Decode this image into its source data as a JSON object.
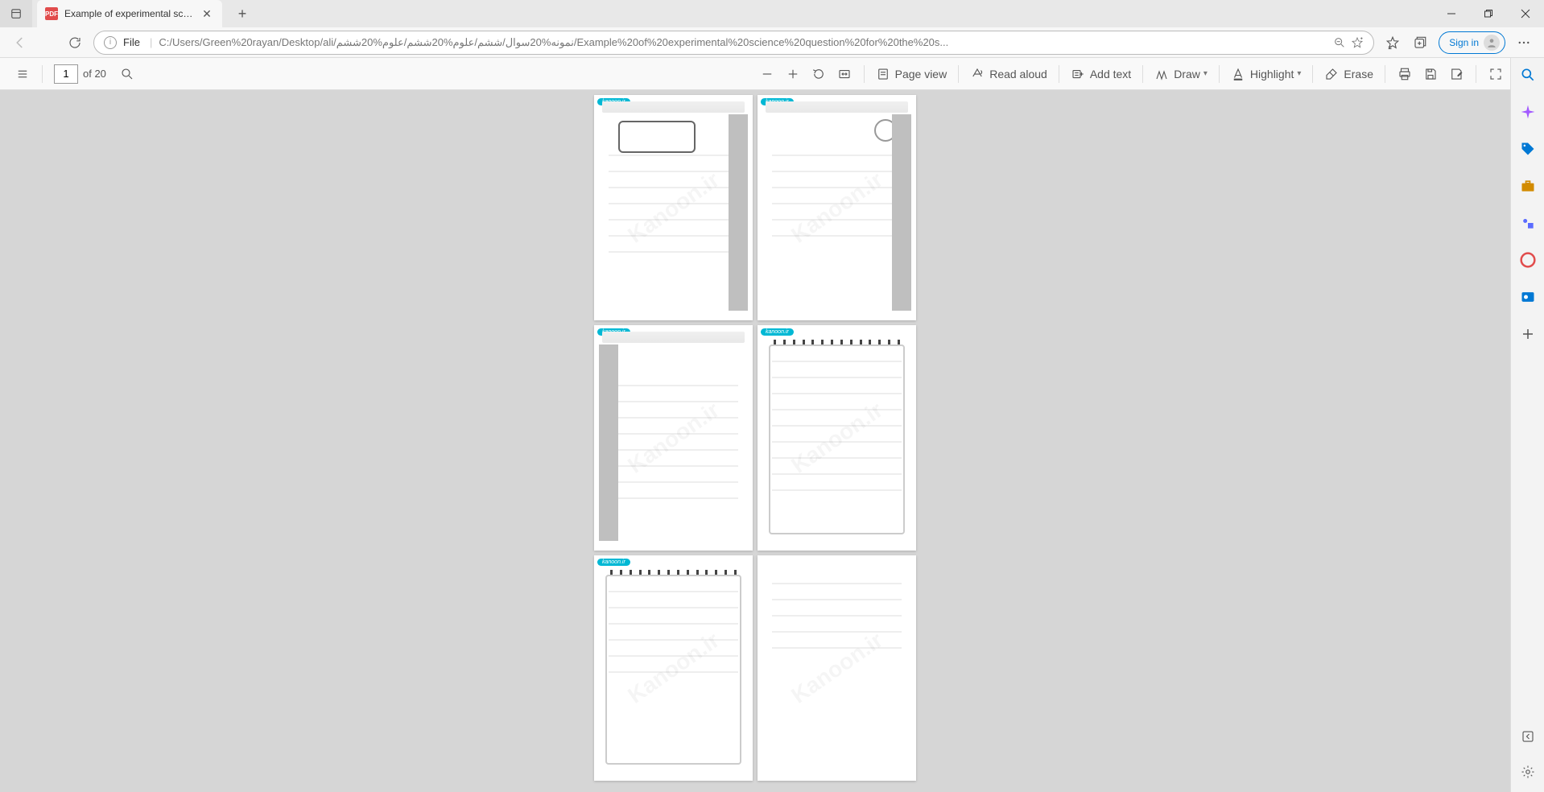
{
  "tab": {
    "title": "Example of experimental science",
    "pdf_badge": "PDF"
  },
  "address": {
    "scheme": "File",
    "path": "C:/Users/Green%20rayan/Desktop/ali/نمونه%20سوال/ششم/علوم%20ششم/علوم%20ششم/Example%20of%20experimental%20science%20question%20for%20the%20s..."
  },
  "signin_label": "Sign in",
  "pdf_toolbar": {
    "current_page": "1",
    "total_pages": "of 20",
    "page_view": "Page view",
    "read_aloud": "Read aloud",
    "add_text": "Add text",
    "draw": "Draw",
    "highlight": "Highlight",
    "erase": "Erase"
  },
  "pages": {
    "watermark": "Kanoon.ir",
    "badge": "kanoon.ir"
  }
}
